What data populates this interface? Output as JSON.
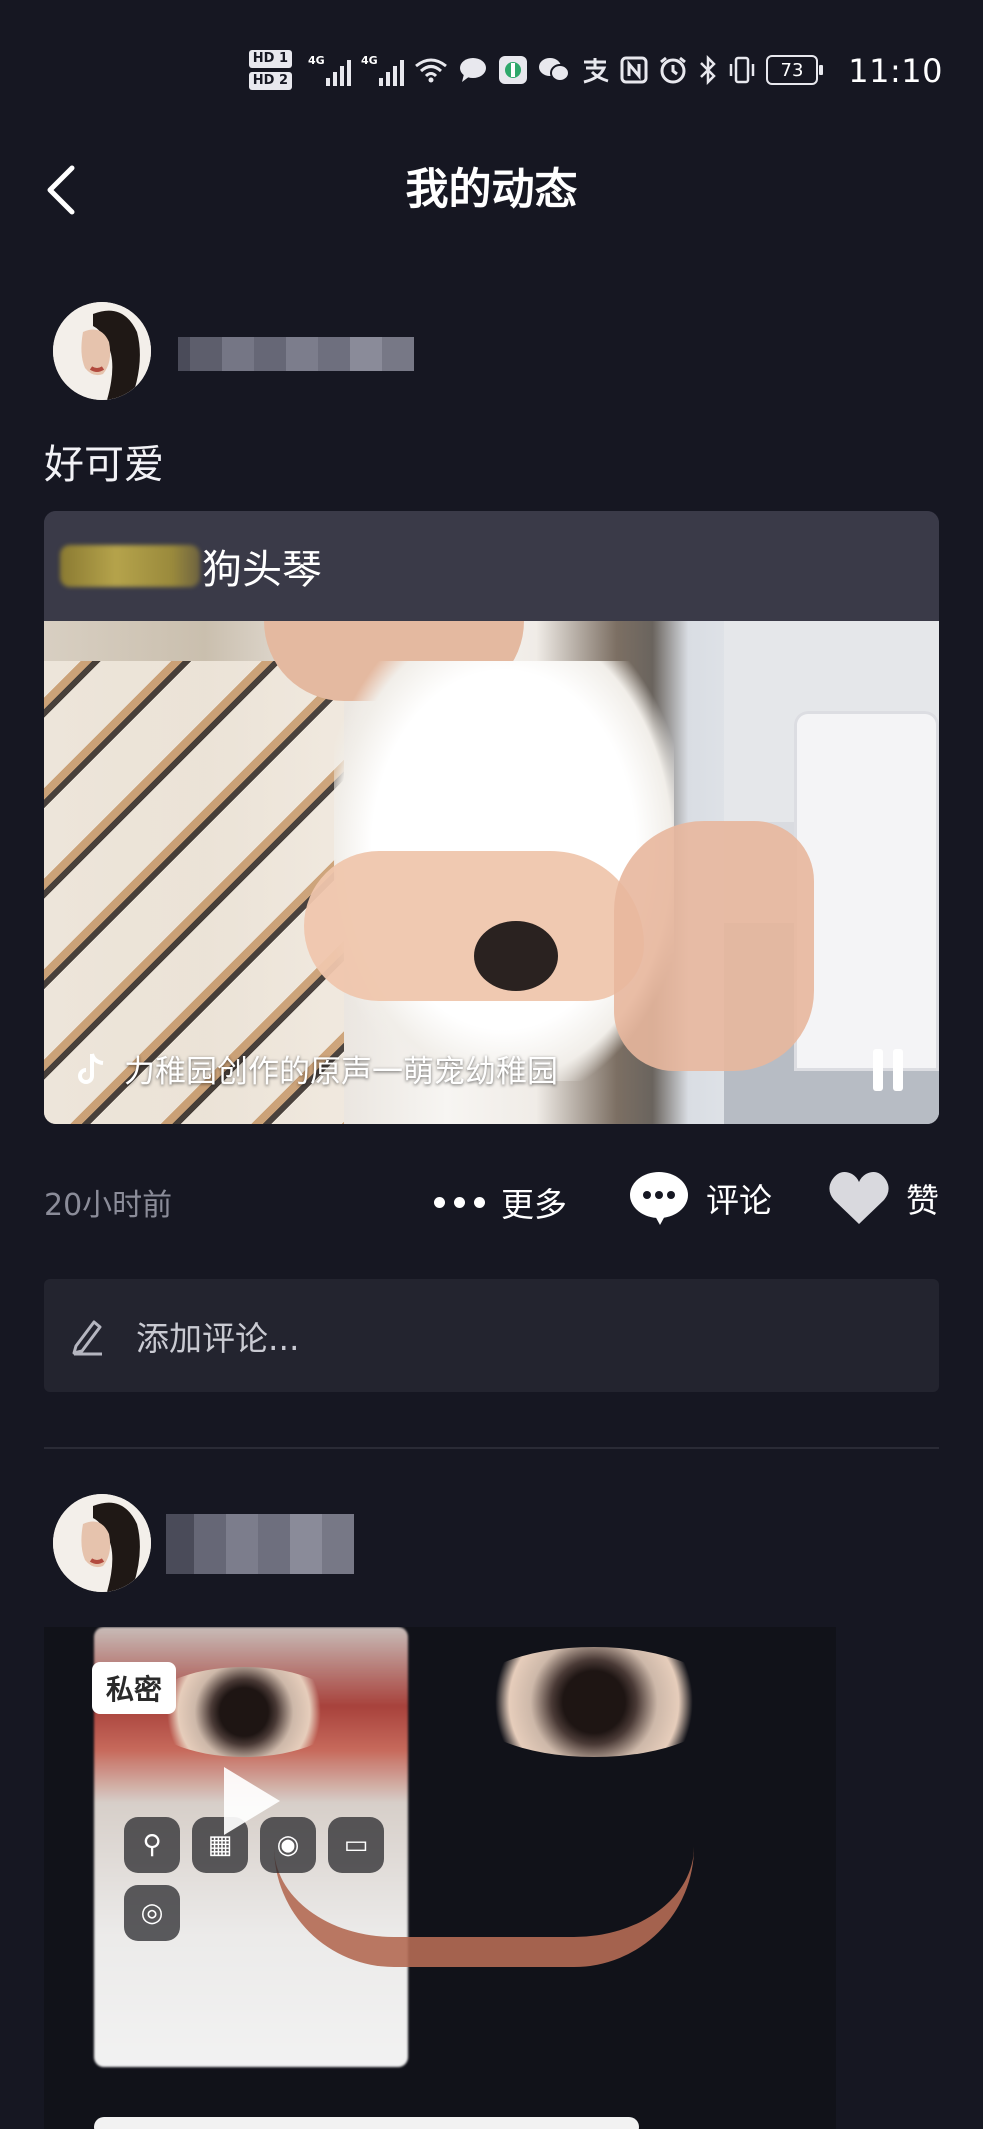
{
  "status_bar": {
    "time": "11:10",
    "battery": "73",
    "hd1": "HD 1",
    "hd2": "HD 2",
    "signal_label": "4G",
    "icons": [
      "hd-icon",
      "signal-4g-icon",
      "signal-4g-icon",
      "wifi-icon",
      "message-icon",
      "app-icon",
      "wechat-icon",
      "alipay-icon",
      "nfc-icon",
      "alarm-icon",
      "bluetooth-icon",
      "vibrate-icon",
      "battery-icon"
    ]
  },
  "header": {
    "title": "我的动态",
    "back_icon": "chevron-left-icon"
  },
  "posts": [
    {
      "caption": "好可爱",
      "card": {
        "name": "狗头琴",
        "music": "力稚园创作的原声一萌宠幼稚园"
      },
      "time": "20小时前",
      "actions": {
        "more": "更多",
        "comment": "评论",
        "like": "赞"
      },
      "comment_placeholder": "添加评论..."
    },
    {
      "badge": "私密"
    }
  ],
  "colors": {
    "background": "#161722",
    "card": "#383846",
    "comment_box": "#23242f",
    "muted_text": "#8b8c99"
  }
}
